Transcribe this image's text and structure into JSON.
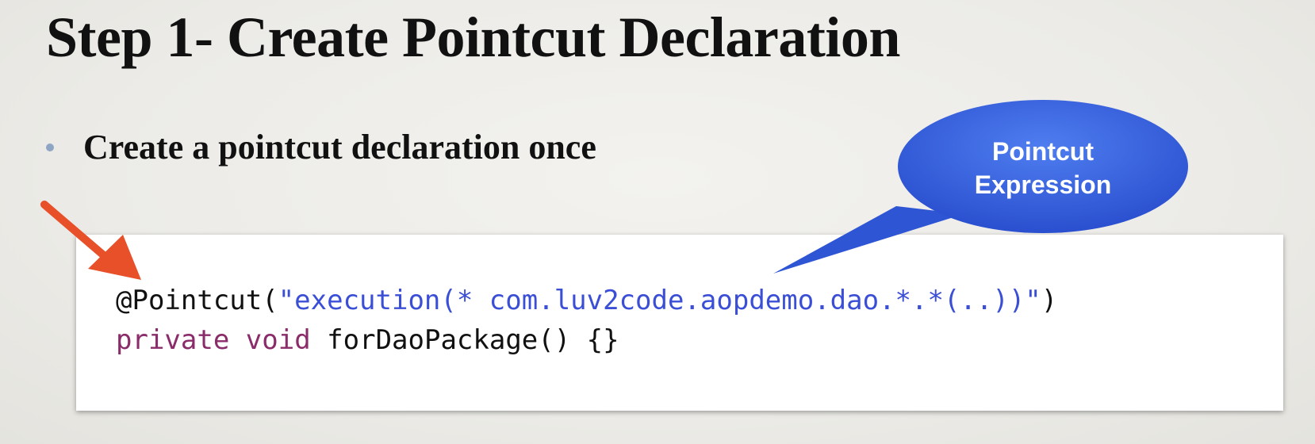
{
  "slide": {
    "title": "Step 1- Create Pointcut Declaration",
    "bullet": "Create a pointcut declaration once"
  },
  "callout": {
    "line1": "Pointcut",
    "line2": "Expression",
    "color": "#3560e0"
  },
  "arrow": {
    "color": "#e8502a"
  },
  "code": {
    "line1": {
      "annotation": "@Pointcut(",
      "string": "\"execution(* com.luv2code.aopdemo.dao.*.*(..))\"",
      "close": ")"
    },
    "line2": {
      "keyword1": "private",
      "keyword2": "void",
      "method": "forDaoPackage() {}"
    }
  }
}
